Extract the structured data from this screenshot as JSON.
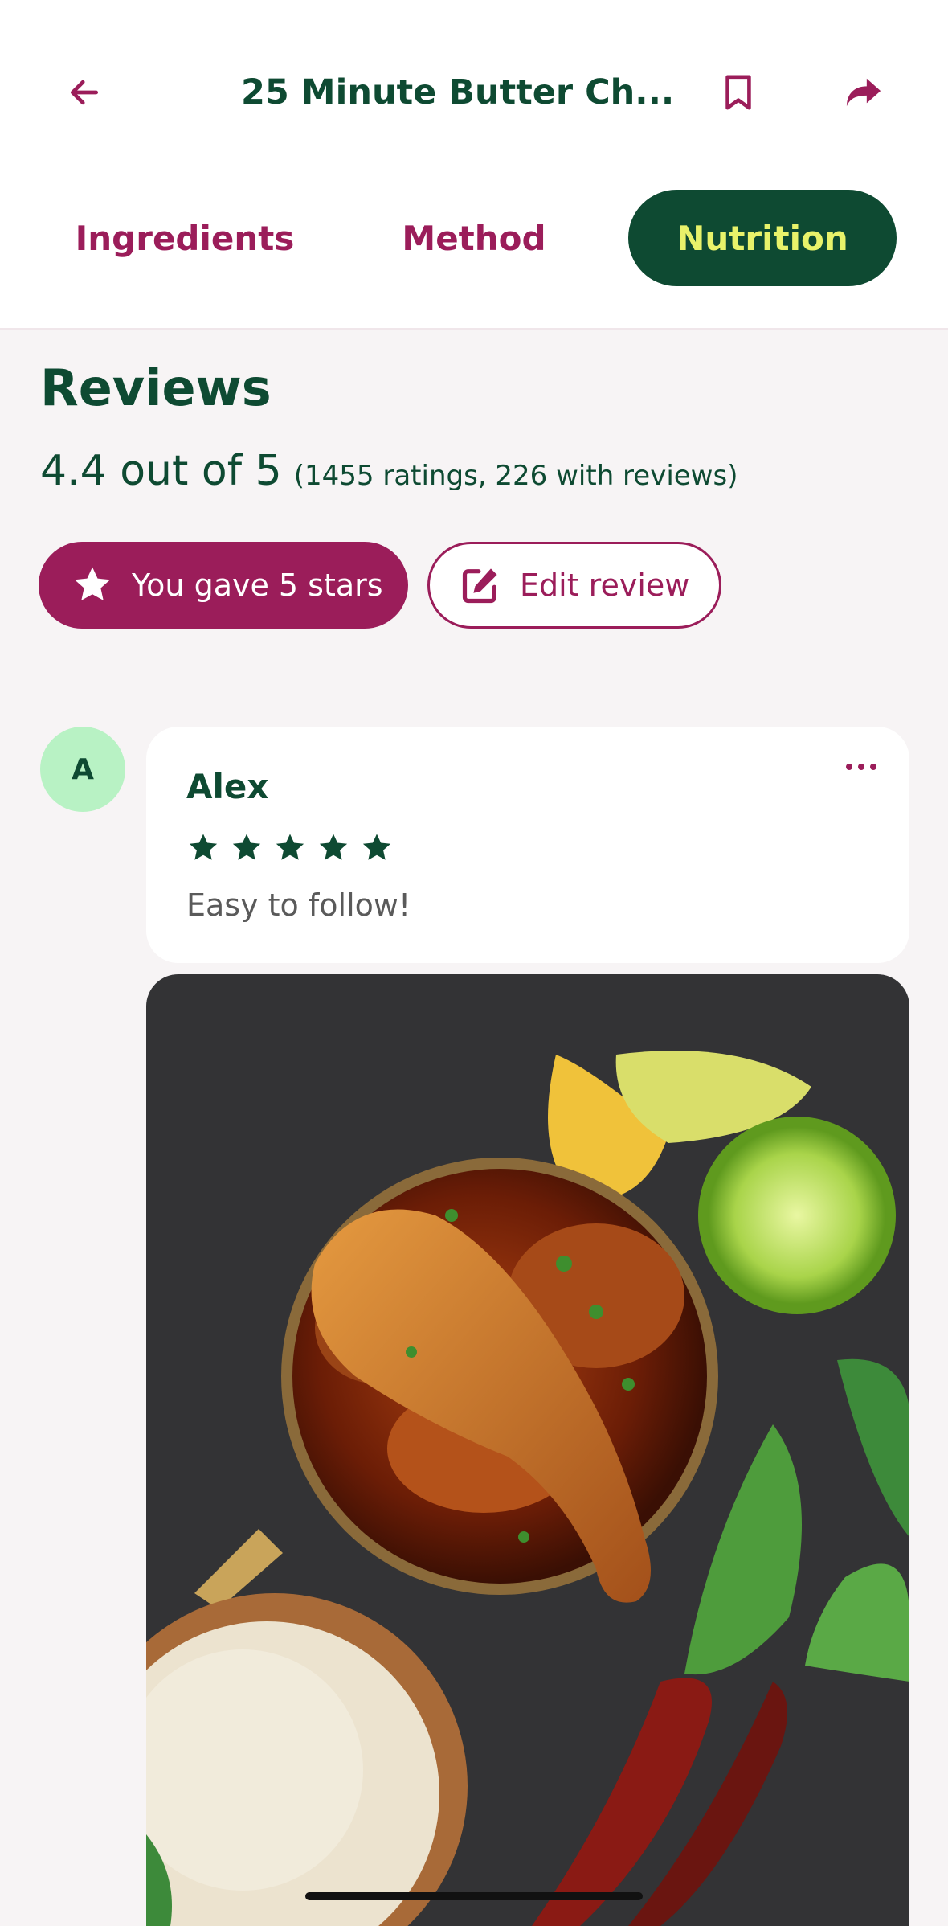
{
  "header": {
    "title": "25 Minute Butter Ch...",
    "back_icon": "arrow-left-icon",
    "bookmark_icon": "bookmark-icon",
    "share_icon": "share-icon"
  },
  "tabs": [
    {
      "label": "Ingredients",
      "active": false
    },
    {
      "label": "Method",
      "active": false
    },
    {
      "label": "Nutrition",
      "active": true
    }
  ],
  "reviews": {
    "title": "Reviews",
    "rating_text": "4.4 out of 5",
    "rating_detail": "(1455 ratings, 226 with reviews)",
    "gave_label": "You gave 5 stars",
    "edit_label": "Edit review"
  },
  "review": {
    "avatar_letter": "A",
    "name": "Alex",
    "stars": 5,
    "comment": "Easy to follow!"
  },
  "colors": {
    "brand_green": "#0e4a32",
    "brand_magenta": "#9b1d5a",
    "accent_lime": "#e8f26a",
    "avatar_bg": "#b8f2c4"
  }
}
